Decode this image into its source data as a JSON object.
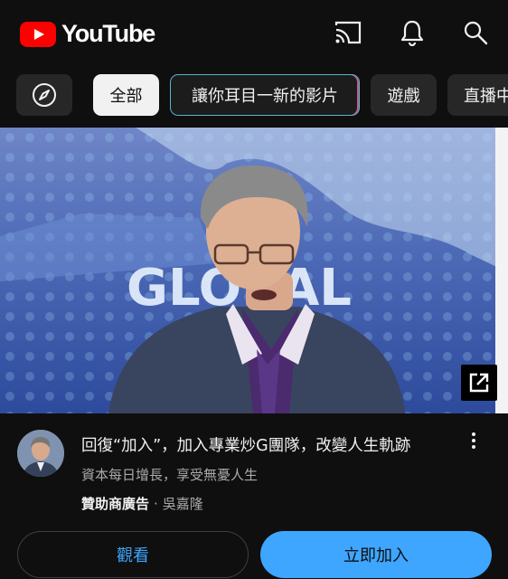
{
  "header": {
    "logo_text": "YouTube",
    "brand_color": "#ff0000",
    "icons": [
      "cast-icon",
      "bell-icon",
      "search-icon"
    ]
  },
  "chips": {
    "explore_icon": "compass-icon",
    "items": [
      {
        "label": "全部",
        "selected": true
      },
      {
        "label": "讓你耳目一新的影片",
        "selected": false
      },
      {
        "label": "遊戲",
        "selected": false
      },
      {
        "label": "直播中",
        "selected": false
      }
    ]
  },
  "video": {
    "backdrop_text": "GLOBAL",
    "open_icon": "open-external-icon"
  },
  "ad": {
    "title": "回復“加入”，加入專業炒G團隊，改變人生軌跡",
    "description": "資本每日增長，享受無憂人生",
    "sponsor_label": "贊助商廣告",
    "separator": "·",
    "advertiser": "吳嘉隆"
  },
  "buttons": {
    "watch_label": "觀看",
    "join_label": "立即加入",
    "accent": "#3ea6ff"
  }
}
